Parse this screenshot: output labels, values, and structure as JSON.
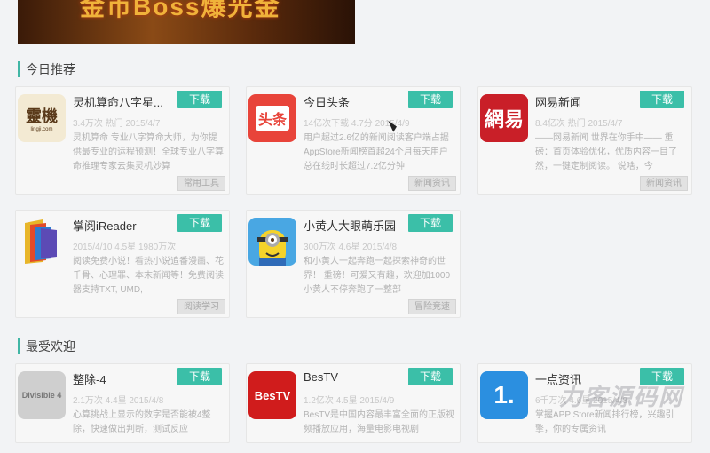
{
  "banner": {
    "text": "金币Boss爆光金"
  },
  "sections": {
    "today": "今日推荐",
    "popular": "最受欢迎"
  },
  "download_label": "下载",
  "apps": [
    {
      "name": "灵机算命八字星...",
      "meta": "3.4万次 热门 2015/4/7",
      "desc": "灵机算命 专业八字算命大师，为你提供最专业的运程预测！全球专业八字算命推理专家云集灵机妙算",
      "tag": "常用工具"
    },
    {
      "name": "今日头条",
      "meta": "14亿次下载 4.7分 2015/4/9",
      "desc": "用户超过2.6亿的新闻阅读客户端占据AppStore新闻榜首超24个月每天用户总在线时长超过7.2亿分钟",
      "tag": "新闻资讯"
    },
    {
      "name": "网易新闻",
      "meta": "8.4亿次 热门 2015/4/7",
      "desc": "——网易新闻 世界在你手中—— 重磅：首页体验优化，优质内容一目了然，一键定制阅读。 说啥，今",
      "tag": "新闻资讯"
    },
    {
      "name": "掌阅iReader",
      "meta": "2015/4/10 4.5星 1980万次",
      "desc": "阅读免费小说！看热小说追番漫画、花千骨、心理罪、本末新闻等！免费阅读器支持TXT, UMD,",
      "tag": "阅读学习"
    },
    {
      "name": "小黄人大眼萌乐园",
      "meta": "300万次 4.6星 2015/4/8",
      "desc": "和小黄人一起奔跑一起探索神奇的世界！ 重磅！可爱又有趣，欢迎加1000小黄人不停奔跑了一整部",
      "tag": "冒险竞速"
    },
    {
      "name": "整除-4",
      "meta": "2.1万次 4.4星 2015/4/8",
      "desc": "心算挑战上显示的数字是否能被4整除，快速做出判断，测试反应",
      "tag": ""
    },
    {
      "name": "BesTV",
      "meta": "1.2亿次 4.5星 2015/4/9",
      "desc": "BesTV是中国内容最丰富全面的正版视频播放应用，海量电影电视剧",
      "tag": ""
    },
    {
      "name": "一点资讯",
      "meta": "6千万次 4.6星 2015/4/8",
      "desc": "掌握APP Store新闻排行榜，兴趣引擎，你的专属资讯",
      "tag": ""
    }
  ],
  "watermark": "力客源码网"
}
